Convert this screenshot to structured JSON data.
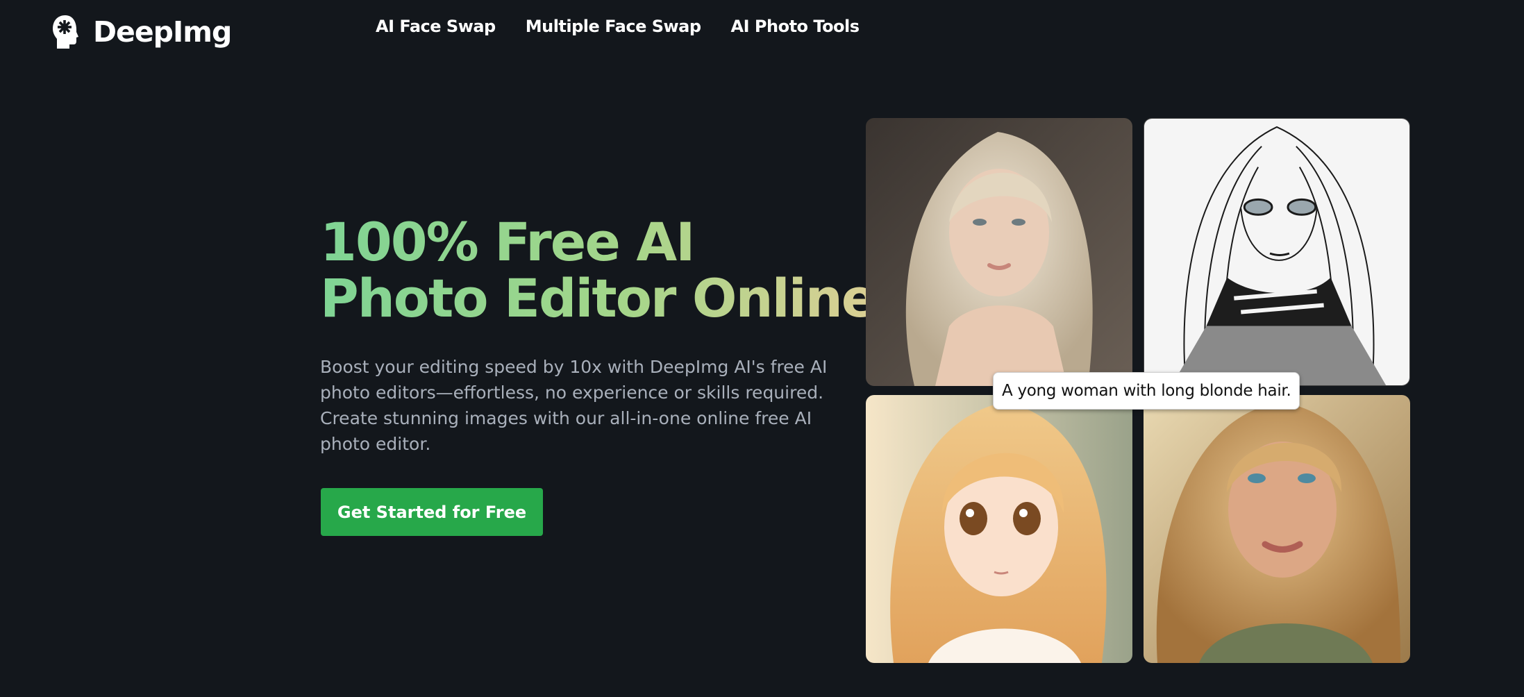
{
  "header": {
    "logo_text": "DeepImg",
    "logo_icon": "head-gear-icon",
    "nav": [
      {
        "label": "AI Face Swap"
      },
      {
        "label": "Multiple Face Swap"
      },
      {
        "label": "AI Photo Tools"
      }
    ]
  },
  "hero": {
    "title_line1": "100% Free AI",
    "title_line2": "Photo Editor Online",
    "description": "Boost your editing speed by 10x with DeepImg AI's free AI photo editors—effortless, no experience or skills required. Create stunning images with our all-in-one online free AI photo editor.",
    "cta_label": "Get Started for Free"
  },
  "gallery": {
    "caption": "A yong woman with long blonde hair."
  },
  "colors": {
    "background": "#13171c",
    "accent_green": "#27a84a",
    "title_gradient_start": "#7fd494",
    "title_gradient_end": "#dccf94",
    "description_text": "#a9b0bb"
  }
}
